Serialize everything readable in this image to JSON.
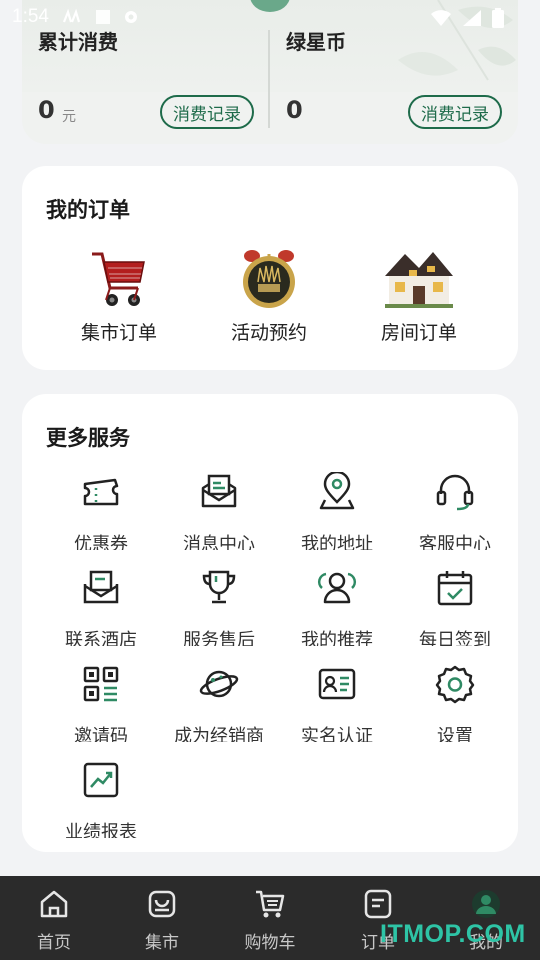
{
  "status_bar": {
    "time": "1:54"
  },
  "stats": {
    "total_spend_title": "累计消费",
    "total_spend_value": "0",
    "total_spend_unit": "元",
    "total_spend_btn": "消费记录",
    "green_coin_title": "绿星币",
    "green_coin_value": "0",
    "green_coin_btn": "消费记录"
  },
  "orders": {
    "title": "我的订单",
    "items": [
      {
        "label": "集市订单",
        "icon": "shopping-cart-icon"
      },
      {
        "label": "活动预约",
        "icon": "alarm-clock-icon"
      },
      {
        "label": "房间订单",
        "icon": "house-icon"
      }
    ]
  },
  "services": {
    "title": "更多服务",
    "items": [
      {
        "label": "优惠券",
        "icon": "coupon-icon"
      },
      {
        "label": "消息中心",
        "icon": "message-icon"
      },
      {
        "label": "我的地址",
        "icon": "location-icon"
      },
      {
        "label": "客服中心",
        "icon": "headset-icon"
      },
      {
        "label": "联系酒店",
        "icon": "contact-hotel-icon"
      },
      {
        "label": "服务售后",
        "icon": "trophy-icon"
      },
      {
        "label": "我的推荐",
        "icon": "recommend-users-icon"
      },
      {
        "label": "每日签到",
        "icon": "calendar-check-icon"
      },
      {
        "label": "邀请码",
        "icon": "qr-code-icon"
      },
      {
        "label": "成为经销商",
        "icon": "planet-icon"
      },
      {
        "label": "实名认证",
        "icon": "id-card-icon"
      },
      {
        "label": "设置",
        "icon": "gear-icon"
      },
      {
        "label": "业绩报表",
        "icon": "chart-report-icon"
      }
    ]
  },
  "nav": {
    "items": [
      {
        "label": "首页",
        "icon": "home-icon"
      },
      {
        "label": "集市",
        "icon": "market-bag-icon"
      },
      {
        "label": "购物车",
        "icon": "cart-icon"
      },
      {
        "label": "订单",
        "icon": "order-list-icon"
      },
      {
        "label": "我的",
        "icon": "profile-icon"
      }
    ]
  },
  "watermark": "ITMOP.COM",
  "colors": {
    "accent": "#1e6b4a",
    "icon_green": "#2f8a64",
    "nav_bg": "#2b2b2b",
    "watermark": "#2ec4a6"
  }
}
